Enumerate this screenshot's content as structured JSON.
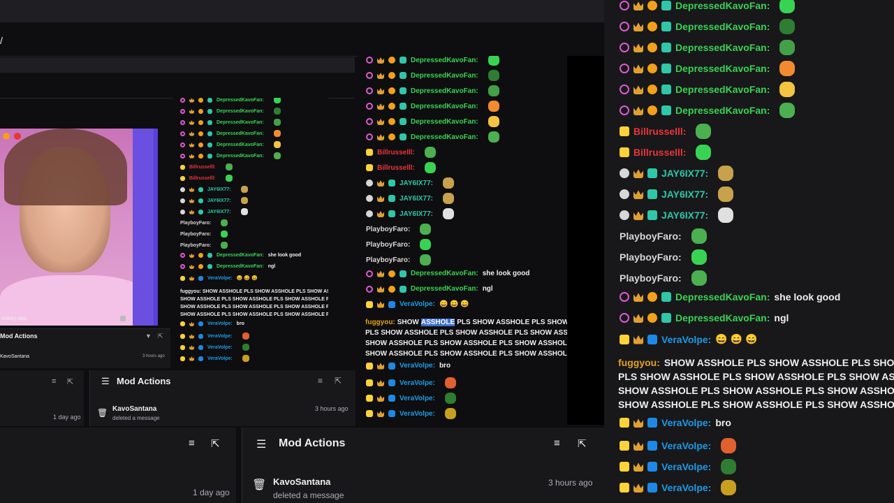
{
  "colors": {
    "depressed": "#39d353",
    "bill": "#e8343a",
    "jay": "#2fc7a8",
    "playboy": "#d7d7d7",
    "vera": "#1e9be6",
    "fuggyou": "#e3a21a"
  },
  "bigChat": {
    "lines": [
      {
        "user": "DepressedKavoFan:",
        "msg": "",
        "badges": [
          "pink",
          "crown",
          "gold",
          "glitch"
        ],
        "color": "#39d353",
        "emote": "#39d353"
      },
      {
        "user": "DepressedKavoFan:",
        "msg": "",
        "badges": [
          "pink",
          "crown",
          "gold",
          "glitch"
        ],
        "color": "#39d353",
        "emote": "#2e7d32"
      },
      {
        "user": "DepressedKavoFan:",
        "msg": "",
        "badges": [
          "pink",
          "crown",
          "gold",
          "glitch"
        ],
        "color": "#39d353",
        "emote": "#43a047"
      },
      {
        "user": "DepressedKavoFan:",
        "msg": "",
        "badges": [
          "pink",
          "crown",
          "gold",
          "glitch"
        ],
        "color": "#39d353",
        "emote": "#f28b30"
      },
      {
        "user": "DepressedKavoFan:",
        "msg": "",
        "badges": [
          "pink",
          "crown",
          "gold",
          "glitch"
        ],
        "color": "#39d353",
        "emote": "#f2c440"
      },
      {
        "user": "DepressedKavoFan:",
        "msg": "",
        "badges": [
          "pink",
          "crown",
          "gold",
          "glitch"
        ],
        "color": "#39d353",
        "emote": "#4caf50"
      },
      {
        "user": "Billrusselll:",
        "msg": "",
        "badges": [
          "sub"
        ],
        "color": "#e8343a",
        "emote": "#4caf50"
      },
      {
        "user": "Billrusselll:",
        "msg": "",
        "badges": [
          "sub"
        ],
        "color": "#e8343a",
        "emote": "#39d353"
      },
      {
        "user": "JAY6IX77:",
        "msg": "",
        "badges": [
          "gray",
          "crown",
          "glitch"
        ],
        "color": "#2fc7a8",
        "emote": "#c8a24a"
      },
      {
        "user": "JAY6IX77:",
        "msg": "",
        "badges": [
          "gray",
          "crown",
          "glitch"
        ],
        "color": "#2fc7a8",
        "emote": "#c8a24a"
      },
      {
        "user": "JAY6IX77:",
        "msg": "",
        "badges": [
          "gray",
          "crown",
          "glitch"
        ],
        "color": "#2fc7a8",
        "emote": "#e0e0e0"
      },
      {
        "user": "PlayboyFaro:",
        "msg": "",
        "badges": [],
        "color": "#d7d7d7",
        "emote": "#4caf50"
      },
      {
        "user": "PlayboyFaro:",
        "msg": "",
        "badges": [],
        "color": "#d7d7d7",
        "emote": "#39d353"
      },
      {
        "user": "PlayboyFaro:",
        "msg": "",
        "badges": [],
        "color": "#d7d7d7",
        "emote": "#4caf50"
      },
      {
        "user": "DepressedKavoFan:",
        "msg": "she look good",
        "badges": [
          "pink",
          "crown",
          "gold",
          "glitch"
        ],
        "color": "#39d353",
        "emote": ""
      },
      {
        "user": "DepressedKavoFan:",
        "msg": "ngl",
        "badges": [
          "pink",
          "crown",
          "gold",
          "glitch"
        ],
        "color": "#39d353",
        "emote": ""
      },
      {
        "user": "VeraVolpe:",
        "msg": "😄 😄 😄",
        "badges": [
          "sub",
          "crown",
          "blue"
        ],
        "color": "#1e9be6",
        "emote": ""
      }
    ],
    "spamUser": "fuggyou:",
    "spamLines": [
      "SHOW ASSHOLE PLS SHOW ASSHOLE PLS SHOW AS",
      "PLS SHOW ASSHOLE PLS SHOW ASSHOLE PLS SHOW ASSHO",
      "SHOW ASSHOLE PLS SHOW ASSHOLE PLS SHOW ASSHOLE PL",
      "SHOW ASSHOLE PLS SHOW ASSHOLE PLS SHOW ASSHOLE PL"
    ],
    "after": [
      {
        "user": "VeraVolpe:",
        "msg": "bro",
        "badges": [
          "sub",
          "crown",
          "blue"
        ],
        "color": "#1e9be6",
        "emote": ""
      },
      {
        "user": "VeraVolpe:",
        "msg": "",
        "badges": [
          "sub",
          "crown",
          "blue"
        ],
        "color": "#1e9be6",
        "emote": "#e06030"
      },
      {
        "user": "VeraVolpe:",
        "msg": "",
        "badges": [
          "sub",
          "crown",
          "blue"
        ],
        "color": "#1e9be6",
        "emote": "#2e7d32"
      },
      {
        "user": "VeraVolpe:",
        "msg": "",
        "badges": [
          "sub",
          "crown",
          "blue"
        ],
        "color": "#1e9be6",
        "emote": "#c8a020"
      }
    ]
  },
  "midChat": {
    "spamUser": "fuggyou:",
    "spamFirst": "SHOW",
    "spamHighlight": "ASSHOLE",
    "spamRest": "PLS SHOW ASSHOLE PLS SHOW AS",
    "spamLines": [
      "PLS SHOW ASSHOLE PLS SHOW ASSHOLE PLS SHOW ASSHO",
      "SHOW ASSHOLE PLS SHOW ASSHOLE PLS SHOW ASSHOLE PI",
      "SHOW ASSHOLE PLS SHOW ASSHOLE PLS SHOW ASSHOLE PI"
    ]
  },
  "smallChat": {
    "spamLines": [
      "fuggyou: SHOW ASSHOLE PLS SHOW ASSHOLE PLS SHOW AS",
      "SHOW ASSHOLE PLS SHOW ASSHOLE PLS SHOW ASSHOLE PLS",
      "SHOW ASSHOLE PLS SHOW ASSHOLE PLS SHOW ASSHOLE PI",
      "SHOW ASSHOLE PLS SHOW ASSHOLE PLS SHOW ASSHOLE PI"
    ],
    "msgs": [
      "she look good",
      "ngl",
      "bro"
    ]
  },
  "modActions": {
    "title": "Mod Actions",
    "user": "KavoSantana",
    "action": "deleted a message",
    "time": "3 hours ago",
    "timeOld": "1 day ago"
  },
  "video": {
    "watermark": "onkey.app"
  }
}
